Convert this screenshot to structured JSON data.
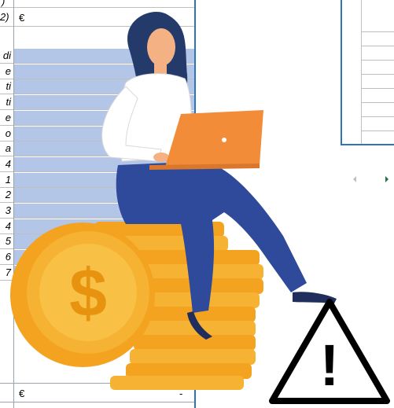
{
  "sheet": {
    "top_row_label": ")",
    "euro_row": {
      "label": "2)",
      "symbol": "€"
    },
    "rows": [
      {
        "label": "di"
      },
      {
        "label": "e"
      },
      {
        "label": "ti"
      },
      {
        "label": "ti"
      },
      {
        "label": "e"
      },
      {
        "label": "o"
      },
      {
        "label": "a"
      },
      {
        "label": "4"
      },
      {
        "label": "1"
      },
      {
        "label": "2"
      },
      {
        "label": "3"
      },
      {
        "label": "4"
      },
      {
        "label": "5"
      },
      {
        "label": "6"
      },
      {
        "label": "7"
      }
    ],
    "total_row": {
      "symbol": "€",
      "value": "-"
    }
  },
  "scrollbar": {
    "left_icon": "arrow-left-icon",
    "right_icon": "arrow-right-icon"
  },
  "illustration": {
    "subject": "woman-with-laptop-icon",
    "coin_icon": "dollar-coin-icon",
    "coin_symbol": "$",
    "warning_icon": "warning-triangle-icon",
    "warning_symbol": "!"
  },
  "colors": {
    "cell_fill": "#b4c6e7",
    "selection_border": "#2e75b6",
    "coin": "#f5a623",
    "laptop": "#f28c38",
    "pants": "#2f4a9a",
    "hair": "#233a6b"
  }
}
